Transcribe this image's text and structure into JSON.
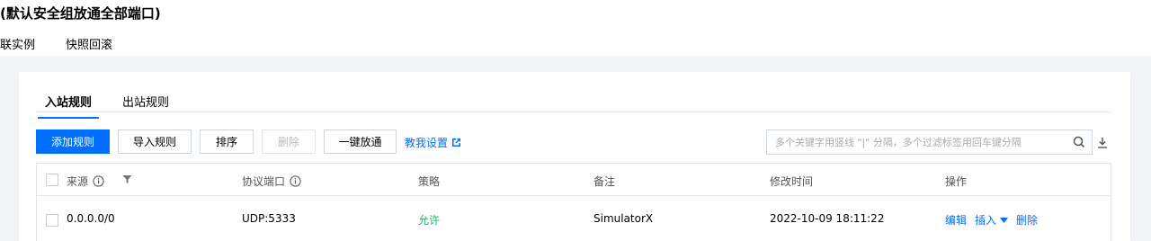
{
  "header": {
    "title": "(默认安全组放通全部端口)",
    "subtabs": [
      "联实例",
      "快照回滚"
    ]
  },
  "tabs": [
    "入站规则",
    "出站规则"
  ],
  "toolbar": {
    "add": "添加规则",
    "import": "导入规则",
    "sort": "排序",
    "delete": "删除",
    "allow_all": "一键放通",
    "help": "教我设置"
  },
  "search": {
    "placeholder": "多个关键字用竖线 \"|\" 分隔，多个过滤标签用回车键分隔"
  },
  "table": {
    "columns": [
      "来源",
      "协议端口",
      "策略",
      "备注",
      "修改时间",
      "操作"
    ],
    "rows": [
      {
        "source": "0.0.0.0/0",
        "port": "UDP:5333",
        "policy": "允许",
        "note": "SimulatorX",
        "time": "2022-10-09 18:11:22",
        "actions": [
          "编辑",
          "插入",
          "删除"
        ]
      }
    ]
  },
  "colors": {
    "accent": "#006eff",
    "allow": "#0abf5b",
    "background": "#f3f4f7"
  }
}
